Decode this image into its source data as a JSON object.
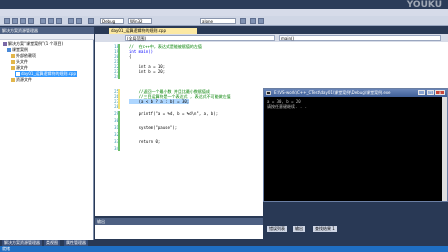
{
  "window": {
    "title": ""
  },
  "toolbar": {
    "config": "Debug",
    "platform": "Win32",
    "find": "alone"
  },
  "watermark": "YOUKU",
  "solution_explorer": {
    "title": "解决方案资源管理器",
    "items": [
      {
        "label": "解决方案“课堂案例”(1 个项目)",
        "selected": false
      },
      {
        "label": "课堂案例",
        "selected": false
      },
      {
        "label": "外部依赖项",
        "selected": false
      },
      {
        "label": "头文件",
        "selected": false
      },
      {
        "label": "源文件",
        "selected": false
      },
      {
        "label": "day01_运算逻辑符的规则.cpp",
        "selected": true
      },
      {
        "label": "资源文件",
        "selected": false
      }
    ]
  },
  "editor": {
    "tab_label": "day01_运算逻辑符的规则.cpp",
    "scope_combo": "(全局范围)",
    "function_combo": "main()",
    "line_numbers": [
      "18",
      "19",
      "20",
      "21",
      "22",
      "23",
      "24",
      "25",
      "26",
      "27",
      "28",
      "29",
      "30",
      "31",
      "32",
      "33",
      "34"
    ],
    "lines": [
      {
        "text": "//  在c++中，表达式是能被赋值的左值",
        "type": "comment"
      },
      {
        "text": "int main()",
        "type": "kw"
      },
      {
        "text": "{",
        "type": "plain"
      },
      {
        "text": "    int a = 10;",
        "type": "plain"
      },
      {
        "text": "    int b = 20;",
        "type": "plain"
      },
      {
        "text": "",
        "type": "plain"
      },
      {
        "text": "",
        "type": "plain"
      },
      {
        "text": "    //返回一个最小数 并且比最小数赋值成",
        "type": "comment"
      },
      {
        "text": "    //三目运算符是一个表达式 , 表达式不可能做左值",
        "type": "comment"
      },
      {
        "text": "    (a < b ? a : b) = 30;",
        "type": "sel"
      },
      {
        "text": "",
        "type": "plain"
      },
      {
        "text": "    printf(\"a = %d, b = %d\\n\", a, b);",
        "type": "plain"
      },
      {
        "text": "",
        "type": "plain"
      },
      {
        "text": "    system(\"pause\");",
        "type": "plain"
      },
      {
        "text": "",
        "type": "plain"
      },
      {
        "text": "    return 0;",
        "type": "plain"
      },
      {
        "text": "",
        "type": "plain"
      }
    ]
  },
  "console": {
    "title": "E:\\VS-work\\C++_CTest\\day01\\课堂案例\\Debug\\课堂案例.exe",
    "lines": [
      "a = 30, b = 20",
      "请按任意键继续. . ."
    ],
    "min_label": "_",
    "max_label": "□",
    "close_label": "x"
  },
  "output_panel": {
    "title": "输出"
  },
  "right_tabs": [
    "错误列表",
    "输出",
    "查找结果 1"
  ],
  "bottom_tabs": [
    "解决方案资源管理器",
    "类视图",
    "属性管理器"
  ],
  "statusbar": {
    "text": "就绪"
  }
}
